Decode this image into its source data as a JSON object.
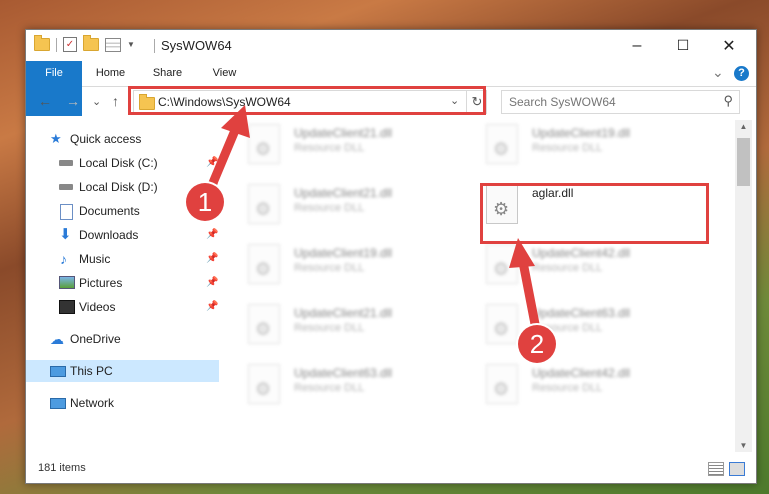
{
  "window": {
    "title": "SysWOW64",
    "minimize": "–",
    "maximize": "☐",
    "close": "✕"
  },
  "ribbon": {
    "tabs": [
      "File",
      "Home",
      "Share",
      "View"
    ],
    "collapse": "⌄",
    "help": "?"
  },
  "nav": {
    "back": "←",
    "forward": "→",
    "recent": "⌄",
    "up": "↑"
  },
  "address": {
    "path": "C:\\Windows\\SysWOW64",
    "dropdown": "⌄",
    "refresh": "↻"
  },
  "search": {
    "placeholder": "Search SysWOW64",
    "icon": "search-icon"
  },
  "sidebar": {
    "quick_access": "Quick access",
    "items": [
      {
        "label": "Local Disk (C:)",
        "icon": "drive-icon",
        "pinned": true
      },
      {
        "label": "Local Disk (D:)",
        "icon": "drive-icon",
        "pinned": true
      },
      {
        "label": "Documents",
        "icon": "documents-icon",
        "pinned": true
      },
      {
        "label": "Downloads",
        "icon": "download-icon",
        "pinned": true
      },
      {
        "label": "Music",
        "icon": "music-icon",
        "pinned": true
      },
      {
        "label": "Pictures",
        "icon": "pictures-icon",
        "pinned": true
      },
      {
        "label": "Videos",
        "icon": "videos-icon",
        "pinned": true
      }
    ],
    "onedrive": "OneDrive",
    "this_pc": "This PC",
    "network": "Network"
  },
  "files": [
    {
      "name": "UpdateClient21.dll",
      "type": "Resource DLL"
    },
    {
      "name": "UpdateClient19.dll",
      "type": "Resource DLL"
    },
    {
      "name": "UpdateClient21.dll",
      "type": "Resource DLL"
    },
    {
      "name": "aglar.dll",
      "type": ""
    },
    {
      "name": "UpdateClient19.dll",
      "type": "Resource DLL"
    },
    {
      "name": "UpdateClient42.dll",
      "type": "Resource DLL"
    },
    {
      "name": "UpdateClient21.dll",
      "type": "Resource DLL"
    },
    {
      "name": "UpdateClient63.dll",
      "type": "Resource DLL"
    },
    {
      "name": "UpdateClient63.dll",
      "type": "Resource DLL"
    },
    {
      "name": "UpdateClient42.dll",
      "type": "Resource DLL"
    }
  ],
  "status": {
    "count": "181 items"
  },
  "callouts": [
    "1",
    "2"
  ],
  "colors": {
    "accent": "#1979ca",
    "highlight": "#e0413f",
    "selected": "#cce8ff"
  }
}
